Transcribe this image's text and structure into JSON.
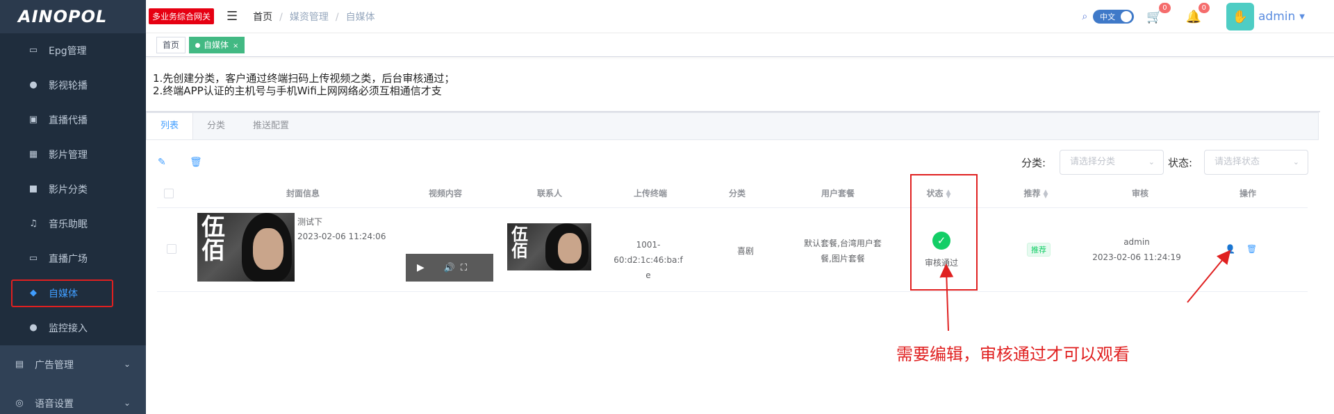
{
  "logo": "AINOPOL",
  "sidebar": {
    "items": [
      {
        "label": "Epg管理",
        "icon": "monitor-icon"
      },
      {
        "label": "影视轮播",
        "icon": "film-loop-icon"
      },
      {
        "label": "直播代播",
        "icon": "radio-icon"
      },
      {
        "label": "影片管理",
        "icon": "film-icon"
      },
      {
        "label": "影片分类",
        "icon": "video-camera-icon"
      },
      {
        "label": "音乐助眠",
        "icon": "music-icon"
      },
      {
        "label": "直播广场",
        "icon": "live-icon"
      },
      {
        "label": "自媒体",
        "icon": "self-media-icon",
        "active": true
      },
      {
        "label": "监控接入",
        "icon": "camera-icon"
      }
    ],
    "groups": [
      {
        "label": "广告管理",
        "icon": "ad-icon"
      },
      {
        "label": "语音设置",
        "icon": "voice-icon"
      }
    ]
  },
  "header": {
    "gateway_badge": "多业务综合网关",
    "breadcrumb": [
      "首页",
      "媒资管理",
      "自媒体"
    ],
    "lang": "中文",
    "cart_count": "0",
    "bell_count": "0",
    "user": "admin"
  },
  "tags": [
    {
      "label": "首页",
      "active": false
    },
    {
      "label": "自媒体",
      "active": true
    }
  ],
  "notice": {
    "line1": "1.先创建分类，客户通过终端扫码上传视频之类，后台审核通过；",
    "line2": "2.终端APP认证的主机号与手机Wifi上网网络必须互相通信才支"
  },
  "tabs": [
    "列表",
    "分类",
    "推送配置"
  ],
  "filters": {
    "category_label": "分类:",
    "category_placeholder": "请选择分类",
    "status_label": "状态:",
    "status_placeholder": "请选择状态"
  },
  "table": {
    "columns": [
      "封面信息",
      "视频内容",
      "联系人",
      "上传终端",
      "分类",
      "用户套餐",
      "状态",
      "推荐",
      "审核",
      "操作"
    ],
    "rows": [
      {
        "title": "测试下",
        "time": "2023-02-06 11:24:06",
        "poster_text": "伍佰",
        "terminal_line1": "1001-60:d2:1c:46:ba:f",
        "terminal_line2": "e",
        "category": "喜剧",
        "package_line1": "默认套餐,台湾用户套",
        "package_line2": "餐,图片套餐",
        "status": "审核通过",
        "recommend": "推荐",
        "reviewer": "admin",
        "review_time": "2023-02-06 11:24:19"
      }
    ]
  },
  "annotation": "需要编辑，审核通过才可以观看",
  "colors": {
    "sidebar_bg": "#304156",
    "accent": "#409eff",
    "success": "#13ce66",
    "annotation_red": "#e02020",
    "tag_green": "#42b983"
  }
}
